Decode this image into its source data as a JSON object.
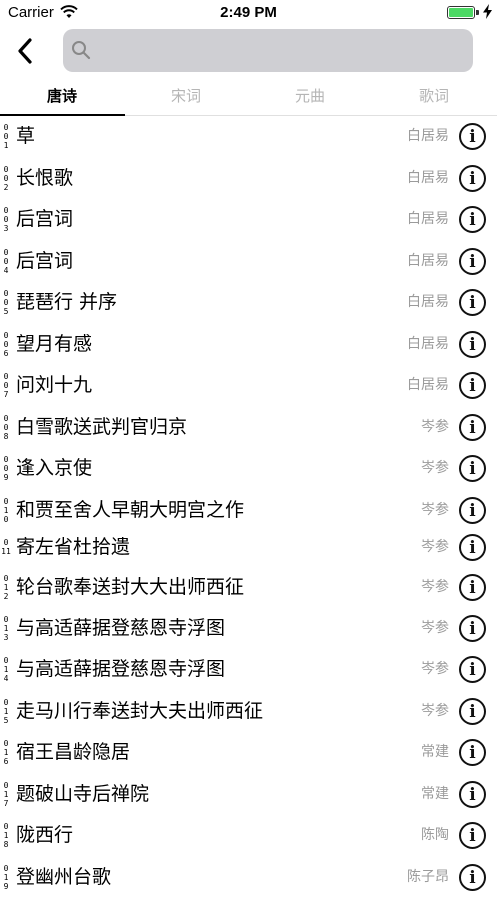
{
  "status_bar": {
    "carrier": "Carrier",
    "time": "2:49 PM",
    "battery_level": 1.0
  },
  "search": {
    "placeholder": "",
    "value": ""
  },
  "tabs": [
    {
      "label": "唐诗",
      "active": true
    },
    {
      "label": "宋词",
      "active": false
    },
    {
      "label": "元曲",
      "active": false
    },
    {
      "label": "歌词",
      "active": false
    }
  ],
  "poems": [
    {
      "index": "0\n0\n1",
      "title": "草",
      "author": "白居易"
    },
    {
      "index": "0\n0\n2",
      "title": "长恨歌",
      "author": "白居易"
    },
    {
      "index": "0\n0\n3",
      "title": "后宫词",
      "author": "白居易"
    },
    {
      "index": "0\n0\n4",
      "title": "后宫词",
      "author": "白居易"
    },
    {
      "index": "0\n0\n5",
      "title": "琵琶行 并序",
      "author": "白居易"
    },
    {
      "index": "0\n0\n6",
      "title": "望月有感",
      "author": "白居易"
    },
    {
      "index": "0\n0\n7",
      "title": "问刘十九",
      "author": "白居易"
    },
    {
      "index": "0\n0\n8",
      "title": "白雪歌送武判官归京",
      "author": "岑参"
    },
    {
      "index": "0\n0\n9",
      "title": "逢入京使",
      "author": "岑参"
    },
    {
      "index": "0\n1\n0",
      "title": "和贾至舍人早朝大明宫之作",
      "author": "岑参"
    },
    {
      "index": "0\n11",
      "title": "寄左省杜拾遗",
      "author": "岑参"
    },
    {
      "index": "0\n1\n2",
      "title": "轮台歌奉送封大大出师西征",
      "author": "岑参"
    },
    {
      "index": "0\n1\n3",
      "title": "与高适薛据登慈恩寺浮图",
      "author": "岑参"
    },
    {
      "index": "0\n1\n4",
      "title": "与高适薛据登慈恩寺浮图",
      "author": "岑参"
    },
    {
      "index": "0\n1\n5",
      "title": "走马川行奉送封大夫出师西征",
      "author": "岑参"
    },
    {
      "index": "0\n1\n6",
      "title": "宿王昌龄隐居",
      "author": "常建"
    },
    {
      "index": "0\n1\n7",
      "title": "题破山寺后禅院",
      "author": "常建"
    },
    {
      "index": "0\n1\n8",
      "title": "陇西行",
      "author": "陈陶"
    },
    {
      "index": "0\n1\n9",
      "title": "登幽州台歌",
      "author": "陈子昂"
    }
  ],
  "info_glyph": "i",
  "icons": {
    "back": "chevron-left-icon",
    "search": "search-icon",
    "info": "info-circle-icon"
  }
}
